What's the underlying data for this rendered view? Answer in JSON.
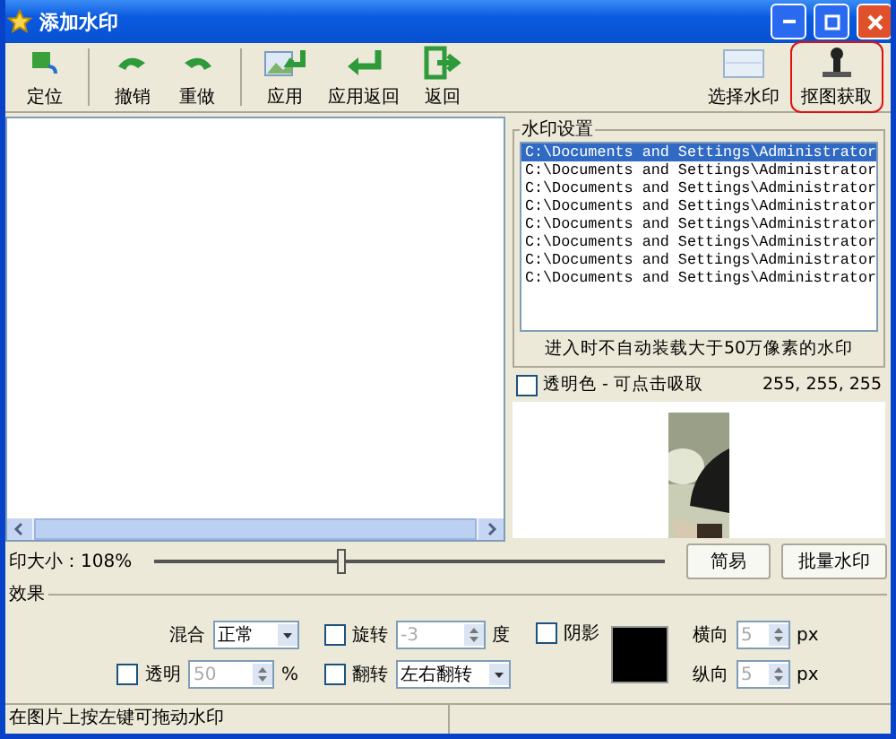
{
  "window": {
    "title": "添加水印"
  },
  "toolbar": [
    {
      "label": "定位"
    },
    {
      "label": "撤销"
    },
    {
      "label": "重做"
    },
    {
      "label": "应用"
    },
    {
      "label": "应用返回"
    },
    {
      "label": "返回"
    }
  ],
  "toolbar_right": [
    {
      "label": "选择水印",
      "highlighted": false
    },
    {
      "label": "抠图获取",
      "highlighted": true
    }
  ],
  "watermark_settings": {
    "title": "水印设置",
    "files": [
      {
        "path": "C:\\Documents and Settings\\Administrator",
        "selected": true
      },
      {
        "path": "C:\\Documents and Settings\\Administrator",
        "selected": false
      },
      {
        "path": "C:\\Documents and Settings\\Administrator",
        "selected": false
      },
      {
        "path": "C:\\Documents and Settings\\Administrator",
        "selected": false
      },
      {
        "path": "C:\\Documents and Settings\\Administrator",
        "selected": false
      },
      {
        "path": "C:\\Documents and Settings\\Administrator",
        "selected": false
      },
      {
        "path": "C:\\Documents and Settings\\Administrator",
        "selected": false
      },
      {
        "path": "C:\\Documents and Settings\\Administrator",
        "selected": false
      }
    ],
    "note": "进入时不自动装载大于50万像素的水印"
  },
  "transparent_color": {
    "label": "透明色 - 可点击吸取",
    "checked": false,
    "value": "255, 255, 255"
  },
  "size": {
    "label": "印大小：108%",
    "level": 0.37
  },
  "buttons": [
    "简易",
    "批量水印"
  ],
  "effects": {
    "title": "效果",
    "blend": {
      "label": "混合",
      "value": "正常"
    },
    "opacity": {
      "label": "透明",
      "checked": false,
      "value": "50",
      "unit": "%"
    },
    "rotate": {
      "label": "旋转",
      "checked": false,
      "value": "-3",
      "unit": "度"
    },
    "flip": {
      "label": "翻转",
      "checked": false,
      "value": "左右翻转"
    },
    "shadow": {
      "label": "阴影",
      "checked": false,
      "color": "#000000"
    },
    "horizontal": {
      "label": "横向",
      "value": "5",
      "unit": "px"
    },
    "vertical": {
      "label": "纵向",
      "value": "5",
      "unit": "px"
    }
  },
  "status_bar": [
    "在图片上按左键可拖动水印"
  ]
}
